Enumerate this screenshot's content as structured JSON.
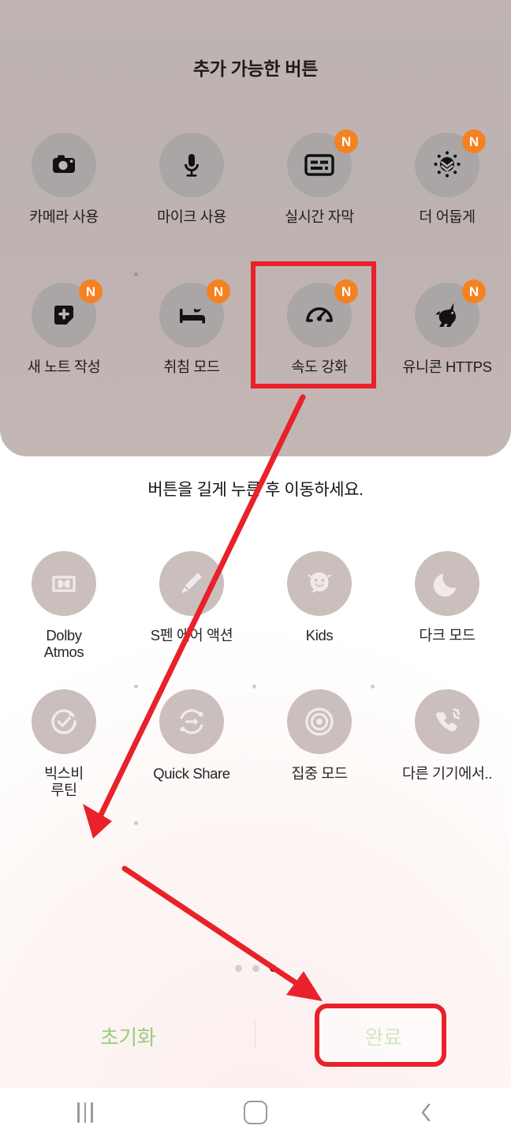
{
  "screen": {
    "panel_bg": "#bfb3b3",
    "accent_green": "#9ccb7f",
    "annotation_red": "#e8212a",
    "badge_orange": "#f58220"
  },
  "available_panel": {
    "title": "추가 가능한 버튼",
    "tiles": [
      {
        "label": "카메라 사용",
        "icon": "camera-icon",
        "badge": ""
      },
      {
        "label": "마이크 사용",
        "icon": "microphone-icon",
        "badge": ""
      },
      {
        "label": "실시간 자막",
        "icon": "live-caption-icon",
        "badge": "N"
      },
      {
        "label": "더 어둡게",
        "icon": "extra-dim-icon",
        "badge": "N"
      },
      {
        "label": "새 노트 작성",
        "icon": "new-note-icon",
        "badge": "N"
      },
      {
        "label": "취침 모드",
        "icon": "bedtime-icon",
        "badge": "N"
      },
      {
        "label": "속도 강화",
        "icon": "speed-boost-icon",
        "badge": "N"
      },
      {
        "label": "유니콘 HTTPS",
        "icon": "unicorn-https-icon",
        "badge": "N"
      }
    ]
  },
  "current_panel": {
    "hint": "버튼을 길게 누른 후 이동하세요.",
    "tiles": [
      {
        "label": "Dolby\nAtmos",
        "icon": "dolby-atmos-icon",
        "badge": ""
      },
      {
        "label": "S펜 에어 액션",
        "icon": "spen-air-action-icon",
        "badge": ""
      },
      {
        "label": "Kids",
        "icon": "kids-icon",
        "badge": ""
      },
      {
        "label": "다크 모드",
        "icon": "dark-mode-icon",
        "badge": ""
      },
      {
        "label": "빅스비\n루틴",
        "icon": "bixby-routines-icon",
        "badge": ""
      },
      {
        "label": "Quick Share",
        "icon": "quick-share-icon",
        "badge": ""
      },
      {
        "label": "집중 모드",
        "icon": "focus-mode-icon",
        "badge": ""
      },
      {
        "label": "다른 기기에서..",
        "icon": "call-continuity-icon",
        "badge": ""
      }
    ]
  },
  "pagination": {
    "count": 3,
    "active_index": 2
  },
  "action_bar": {
    "reset_label": "초기화",
    "done_label": "완료"
  },
  "nav_bar": {
    "recents": "recents-icon",
    "home": "home-icon",
    "back": "back-icon",
    "back_glyph": "‹"
  }
}
